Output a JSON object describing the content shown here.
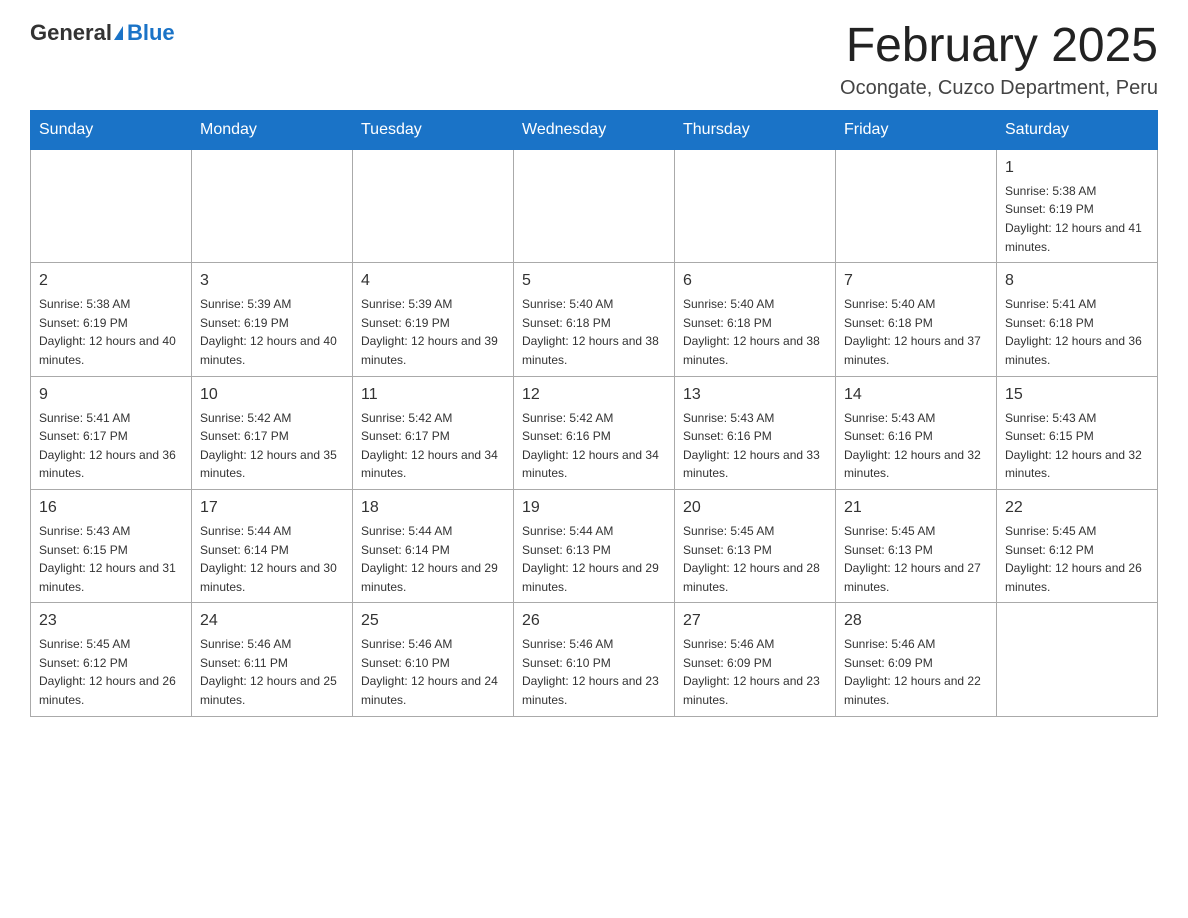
{
  "header": {
    "logo": {
      "general": "General",
      "blue": "Blue"
    },
    "title": "February 2025",
    "location": "Ocongate, Cuzco Department, Peru"
  },
  "days_of_week": [
    "Sunday",
    "Monday",
    "Tuesday",
    "Wednesday",
    "Thursday",
    "Friday",
    "Saturday"
  ],
  "weeks": [
    [
      {
        "day": "",
        "info": ""
      },
      {
        "day": "",
        "info": ""
      },
      {
        "day": "",
        "info": ""
      },
      {
        "day": "",
        "info": ""
      },
      {
        "day": "",
        "info": ""
      },
      {
        "day": "",
        "info": ""
      },
      {
        "day": "1",
        "info": "Sunrise: 5:38 AM\nSunset: 6:19 PM\nDaylight: 12 hours and 41 minutes."
      }
    ],
    [
      {
        "day": "2",
        "info": "Sunrise: 5:38 AM\nSunset: 6:19 PM\nDaylight: 12 hours and 40 minutes."
      },
      {
        "day": "3",
        "info": "Sunrise: 5:39 AM\nSunset: 6:19 PM\nDaylight: 12 hours and 40 minutes."
      },
      {
        "day": "4",
        "info": "Sunrise: 5:39 AM\nSunset: 6:19 PM\nDaylight: 12 hours and 39 minutes."
      },
      {
        "day": "5",
        "info": "Sunrise: 5:40 AM\nSunset: 6:18 PM\nDaylight: 12 hours and 38 minutes."
      },
      {
        "day": "6",
        "info": "Sunrise: 5:40 AM\nSunset: 6:18 PM\nDaylight: 12 hours and 38 minutes."
      },
      {
        "day": "7",
        "info": "Sunrise: 5:40 AM\nSunset: 6:18 PM\nDaylight: 12 hours and 37 minutes."
      },
      {
        "day": "8",
        "info": "Sunrise: 5:41 AM\nSunset: 6:18 PM\nDaylight: 12 hours and 36 minutes."
      }
    ],
    [
      {
        "day": "9",
        "info": "Sunrise: 5:41 AM\nSunset: 6:17 PM\nDaylight: 12 hours and 36 minutes."
      },
      {
        "day": "10",
        "info": "Sunrise: 5:42 AM\nSunset: 6:17 PM\nDaylight: 12 hours and 35 minutes."
      },
      {
        "day": "11",
        "info": "Sunrise: 5:42 AM\nSunset: 6:17 PM\nDaylight: 12 hours and 34 minutes."
      },
      {
        "day": "12",
        "info": "Sunrise: 5:42 AM\nSunset: 6:16 PM\nDaylight: 12 hours and 34 minutes."
      },
      {
        "day": "13",
        "info": "Sunrise: 5:43 AM\nSunset: 6:16 PM\nDaylight: 12 hours and 33 minutes."
      },
      {
        "day": "14",
        "info": "Sunrise: 5:43 AM\nSunset: 6:16 PM\nDaylight: 12 hours and 32 minutes."
      },
      {
        "day": "15",
        "info": "Sunrise: 5:43 AM\nSunset: 6:15 PM\nDaylight: 12 hours and 32 minutes."
      }
    ],
    [
      {
        "day": "16",
        "info": "Sunrise: 5:43 AM\nSunset: 6:15 PM\nDaylight: 12 hours and 31 minutes."
      },
      {
        "day": "17",
        "info": "Sunrise: 5:44 AM\nSunset: 6:14 PM\nDaylight: 12 hours and 30 minutes."
      },
      {
        "day": "18",
        "info": "Sunrise: 5:44 AM\nSunset: 6:14 PM\nDaylight: 12 hours and 29 minutes."
      },
      {
        "day": "19",
        "info": "Sunrise: 5:44 AM\nSunset: 6:13 PM\nDaylight: 12 hours and 29 minutes."
      },
      {
        "day": "20",
        "info": "Sunrise: 5:45 AM\nSunset: 6:13 PM\nDaylight: 12 hours and 28 minutes."
      },
      {
        "day": "21",
        "info": "Sunrise: 5:45 AM\nSunset: 6:13 PM\nDaylight: 12 hours and 27 minutes."
      },
      {
        "day": "22",
        "info": "Sunrise: 5:45 AM\nSunset: 6:12 PM\nDaylight: 12 hours and 26 minutes."
      }
    ],
    [
      {
        "day": "23",
        "info": "Sunrise: 5:45 AM\nSunset: 6:12 PM\nDaylight: 12 hours and 26 minutes."
      },
      {
        "day": "24",
        "info": "Sunrise: 5:46 AM\nSunset: 6:11 PM\nDaylight: 12 hours and 25 minutes."
      },
      {
        "day": "25",
        "info": "Sunrise: 5:46 AM\nSunset: 6:10 PM\nDaylight: 12 hours and 24 minutes."
      },
      {
        "day": "26",
        "info": "Sunrise: 5:46 AM\nSunset: 6:10 PM\nDaylight: 12 hours and 23 minutes."
      },
      {
        "day": "27",
        "info": "Sunrise: 5:46 AM\nSunset: 6:09 PM\nDaylight: 12 hours and 23 minutes."
      },
      {
        "day": "28",
        "info": "Sunrise: 5:46 AM\nSunset: 6:09 PM\nDaylight: 12 hours and 22 minutes."
      },
      {
        "day": "",
        "info": ""
      }
    ]
  ]
}
